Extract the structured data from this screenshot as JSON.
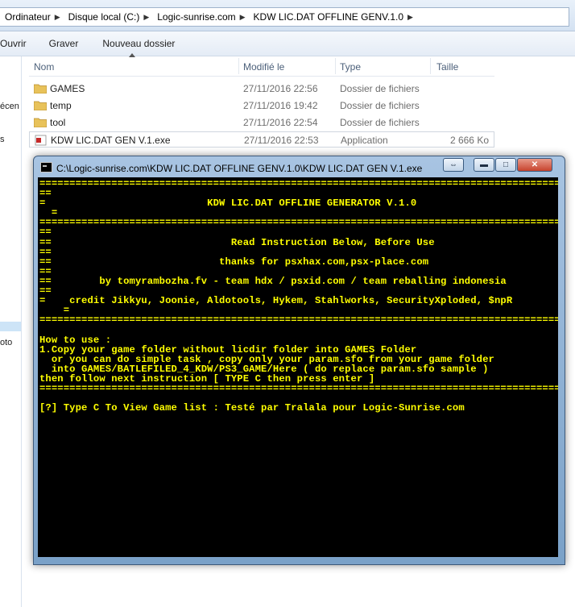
{
  "breadcrumb": [
    "Ordinateur",
    "Disque local (C:)",
    "Logic-sunrise.com",
    "KDW LIC.DAT OFFLINE GENV.1.0"
  ],
  "toolbar": {
    "open": "Ouvrir",
    "burn": "Graver",
    "new_folder": "Nouveau dossier"
  },
  "navpane": {
    "item1": "écen",
    "item2": "s",
    "item3": "oto"
  },
  "columns": {
    "name": "Nom",
    "modified": "Modifié le",
    "type": "Type",
    "size": "Taille"
  },
  "files": [
    {
      "name": "GAMES",
      "date": "27/11/2016 22:56",
      "type": "Dossier de fichiers",
      "size": "",
      "icon": "folder-icon"
    },
    {
      "name": "temp",
      "date": "27/11/2016 19:42",
      "type": "Dossier de fichiers",
      "size": "",
      "icon": "folder-icon"
    },
    {
      "name": "tool",
      "date": "27/11/2016 22:54",
      "type": "Dossier de fichiers",
      "size": "",
      "icon": "folder-icon"
    },
    {
      "name": "KDW LIC.DAT GEN V.1.exe",
      "date": "27/11/2016 22:53",
      "type": "Application",
      "size": "2 666 Ko",
      "icon": "exe-icon"
    }
  ],
  "console_window": {
    "title": "C:\\Logic-sunrise.com\\KDW LIC.DAT OFFLINE GENV.1.0\\KDW LIC.DAT GEN V.1.exe",
    "buttons": {
      "restore": "⇔",
      "minimize": "▬",
      "maximize": "□",
      "close": "✕"
    },
    "lines": [
      "==============================================================================================",
      "==",
      "=                           KDW LIC.DAT OFFLINE GENERATOR V.1.0",
      "  =",
      "==============================================================================================",
      "==",
      "==                              Read Instruction Below, Before Use",
      "==",
      "==                            thanks for psxhax.com,psx-place.com",
      "==",
      "==        by tomyrambozha.fv - team hdx / psxid.com / team reballing indonesia",
      "==",
      "=    credit Jikkyu, Joonie, Aldotools, Hykem, Stahlworks, SecurityXploded, $npR",
      "    =",
      "==============================================================================================",
      "",
      "How to use :",
      "1.Copy your game folder without licdir folder into GAMES Folder",
      "  or you can do simple task , copy only your param.sfo from your game folder",
      "  into GAMES/BATLEFILED_4_KDW/PS3_GAME/Here ( do replace param.sfo sample )",
      "then follow next instruction [ TYPE C then press enter ]",
      "==============================================================================================",
      "",
      "[?] Type C To View Game list : Testé par Tralala pour Logic-Sunrise.com"
    ]
  },
  "colors": {
    "console_bg": "#000000",
    "console_text": "#ffff00",
    "folder": "#e8c25a"
  }
}
